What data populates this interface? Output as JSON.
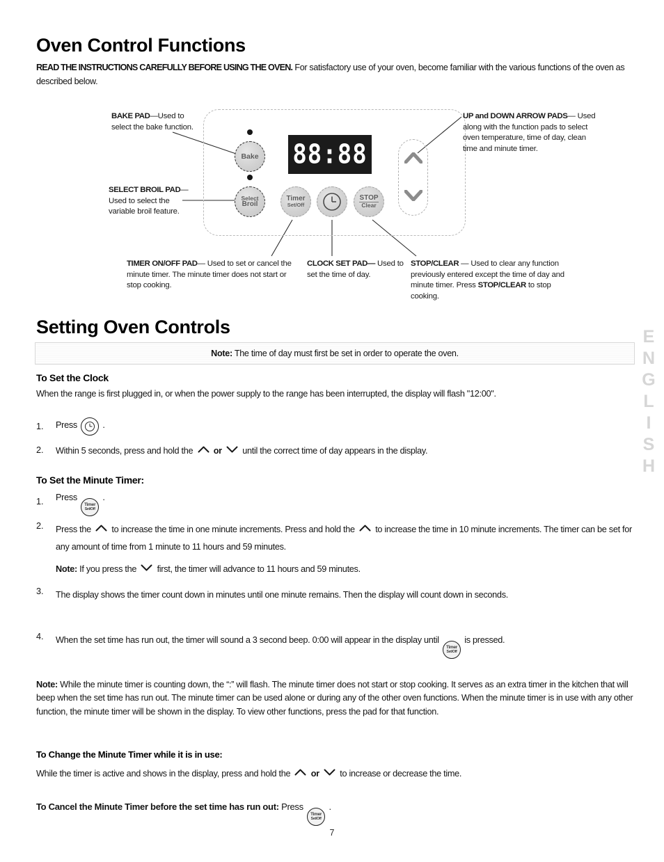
{
  "document": {
    "title": "Oven Control Functions",
    "page_number": "7",
    "side_tab": "ENGLISH"
  },
  "intro": {
    "bold_lead": "READ THE INSTRUCTIONS CAREFULLY BEFORE USING THE OVEN.",
    "rest": " For satisfactory use of your oven, become familiar with the various functions of the oven as described below."
  },
  "diagram": {
    "display_value": "88:88",
    "pads": {
      "bake": "Bake",
      "select_broil_line1": "Select",
      "select_broil_line2": "Broil",
      "timer_line1": "Timer",
      "timer_line2": "Set/Off",
      "clock": "clock-dial",
      "stop_line1": "STOP",
      "stop_line2": "Clear",
      "arrow_up": "chevron-up",
      "arrow_down": "chevron-down"
    },
    "callouts": {
      "bake_bold": "BAKE PAD",
      "bake_rest": "—Used to select the bake function.",
      "broil_bold": "SELECT BROIL PAD",
      "broil_rest": "— Used to select the variable broil feature.",
      "arrows_bold": "UP and DOWN ARROW PADS",
      "arrows_rest": "— Used along with the function pads to select oven temperature, time of day, clean time and minute timer.",
      "timer_bold": "TIMER ON/OFF PAD",
      "timer_rest": "— Used to set or cancel the minute timer. The minute timer does not start or stop cooking.",
      "clock_bold": "CLOCK SET PAD—",
      "clock_rest": " Used to set the time of day.",
      "stop_bold": "STOP/CLEAR",
      "stop_rest_a": " — Used to clear any function previously entered except the time of day and minute timer. Press ",
      "stop_bold_b": "STOP/CLEAR",
      "stop_rest_b": " to stop cooking."
    }
  },
  "setting_section": {
    "heading": "Setting Oven Controls",
    "note_bold": "Note:",
    "note_text": " The time of day must first be set in order to operate the oven."
  },
  "clock_section": {
    "heading": "To Set the Clock",
    "intro": "When the range is first plugged in, or when the power supply to the range has been interrupted, the display will flash \"12:00\".",
    "step1_num": "1.",
    "step1_text": "Press",
    "step1_suffix": ".",
    "step2_num": "2.",
    "step2_a": "Within 5 seconds, press and hold the",
    "step2_or": "or",
    "step2_b": "until the correct time of day appears in the display."
  },
  "timer_section": {
    "heading": "To Set the Minute Timer:",
    "step1_num": "1.",
    "step1_text": "Press",
    "step1_suffix": ".",
    "step2_num": "2.",
    "step2_a": "Press the",
    "step2_b": "to increase the time in one minute increments. Press and hold the",
    "step2_c": "to increase the time in 10 minute increments. The timer can be set for any amount of time from 1 minute to 11 hours and 59 minutes.",
    "step2_note_bold": "Note:",
    "step2_note_a": " If you press the",
    "step2_note_b": "first, the timer will advance to 11 hours and 59 minutes.",
    "step3_num": "3.",
    "step3_text": "The display shows the timer count down in minutes until one minute remains. Then the display will count down in seconds.",
    "step4_num": "4.",
    "step4_a": "When the set time has run out, the timer will sound a 3 second beep. 0:00 will appear in the display until",
    "step4_b": "is pressed."
  },
  "big_note": {
    "bold": "Note:",
    "text": " While the minute timer is counting down, the “:” will flash. The minute timer does not start or stop cooking. It serves as an extra timer in the kitchen that will beep when the set time has run out. The minute timer can be used alone or during any of the other oven functions. When the minute timer is in use with any other function, the minute timer will be shown in the display. To view other functions, press the pad for that function."
  },
  "change_section": {
    "heading": "To Change the Minute Timer while it is in use:",
    "text_a": "While the timer is active and shows in the display, press and hold the",
    "text_or": "or",
    "text_b": "to increase or decrease the time."
  },
  "cancel_section": {
    "heading_bold": "To Cancel the Minute Timer before the set time has run out:",
    "press_label": " Press",
    "suffix": "."
  }
}
